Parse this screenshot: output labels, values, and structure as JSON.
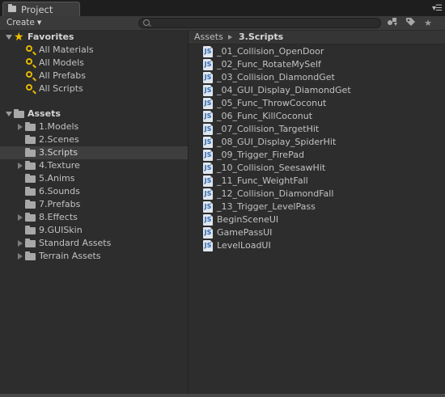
{
  "window": {
    "tab_title": "Project"
  },
  "toolbar": {
    "create_label": "Create",
    "search_placeholder": "",
    "icons": [
      "filter-by-type-icon",
      "filter-by-label-icon",
      "favorites-star-icon"
    ]
  },
  "favorites": {
    "title": "Favorites",
    "items": [
      {
        "label": "All Materials"
      },
      {
        "label": "All Models"
      },
      {
        "label": "All Prefabs"
      },
      {
        "label": "All Scripts"
      }
    ]
  },
  "assets_tree": {
    "title": "Assets",
    "items": [
      {
        "label": "1.Models",
        "expandable": true,
        "selected": false
      },
      {
        "label": "2.Scenes",
        "expandable": false,
        "selected": false
      },
      {
        "label": "3.Scripts",
        "expandable": false,
        "selected": true
      },
      {
        "label": "4.Texture",
        "expandable": true,
        "selected": false
      },
      {
        "label": "5.Anims",
        "expandable": false,
        "selected": false
      },
      {
        "label": "6.Sounds",
        "expandable": false,
        "selected": false
      },
      {
        "label": "7.Prefabs",
        "expandable": false,
        "selected": false
      },
      {
        "label": "8.Effects",
        "expandable": true,
        "selected": false
      },
      {
        "label": "9.GUISkin",
        "expandable": false,
        "selected": false
      },
      {
        "label": "Standard Assets",
        "expandable": true,
        "selected": false
      },
      {
        "label": "Terrain Assets",
        "expandable": true,
        "selected": false
      }
    ]
  },
  "breadcrumb": {
    "root": "Assets",
    "current": "3.Scripts"
  },
  "files": {
    "icon_text": "JS",
    "items": [
      "_01_Collision_OpenDoor",
      "_02_Func_RotateMySelf",
      "_03_Collision_DiamondGet",
      "_04_GUI_Display_DiamondGet",
      "_05_Func_ThrowCoconut",
      "_06_Func_KillCoconut",
      "_07_Collision_TargetHit",
      "_08_GUI_Display_SpiderHit",
      "_09_Trigger_FirePad",
      "_10_Collision_SeesawHit",
      "_11_Func_WeightFall",
      "_12_Collision_DiamondFall",
      "_13_Trigger_LevelPass",
      "BeginSceneUI",
      "GamePassUI",
      "LevelLoadUI"
    ]
  },
  "colors": {
    "selection": "#3e3e3e",
    "favorite_star": "#f0c000",
    "js_icon_text": "#2d68b3"
  }
}
